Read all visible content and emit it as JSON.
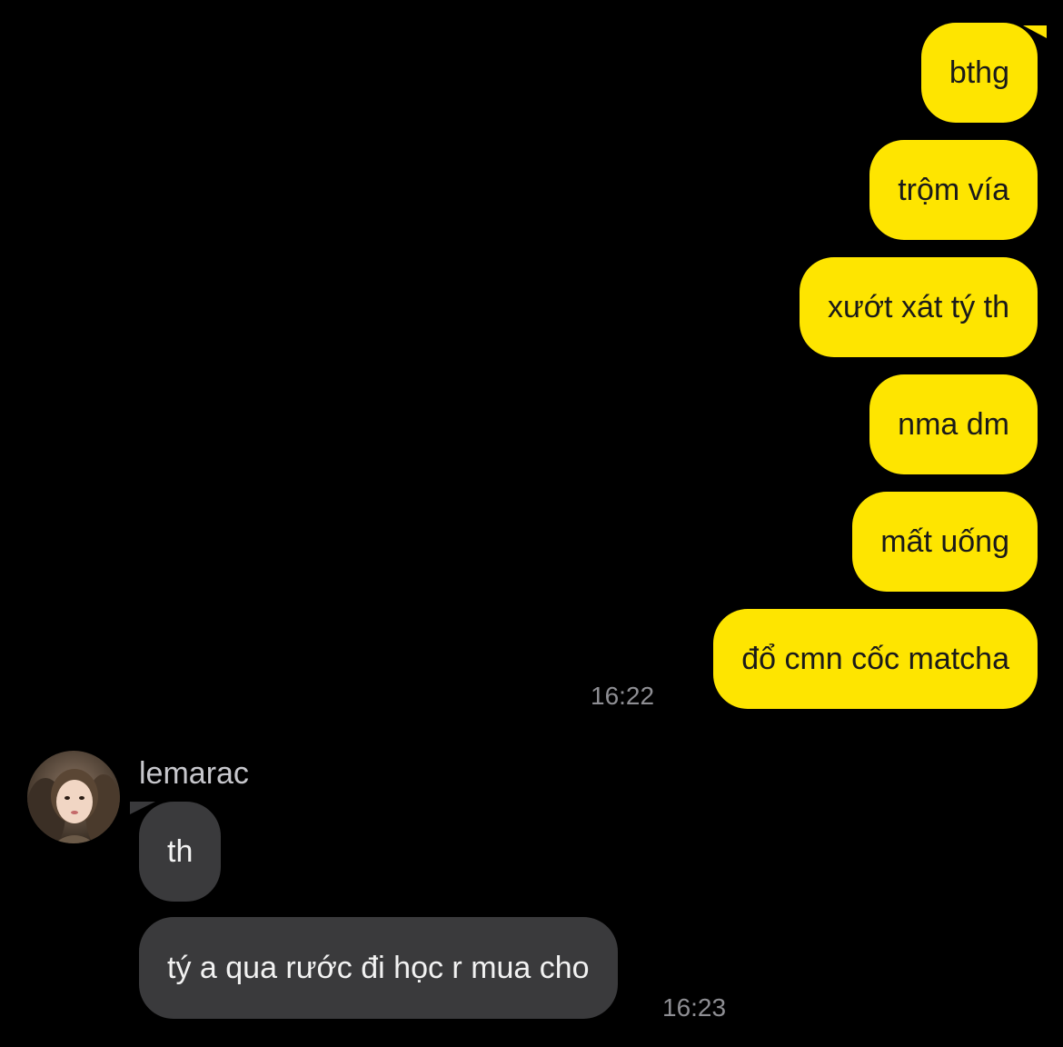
{
  "conversation": {
    "outgoing": [
      {
        "text": "bthg"
      },
      {
        "text": "trộm vía"
      },
      {
        "text": "xướt xát tý th"
      },
      {
        "text": "nma dm"
      },
      {
        "text": "mất uống"
      },
      {
        "text": "đổ cmn cốc matcha"
      }
    ],
    "outgoing_time": "16:22",
    "incoming": {
      "sender": "lemarac",
      "avatar_icon": "user-avatar-photo",
      "messages": [
        {
          "text": "th"
        },
        {
          "text": "tý a qua rước đi học r mua cho"
        }
      ],
      "time": "16:23"
    }
  },
  "colors": {
    "background": "#000000",
    "outgoing_bubble": "#FEE500",
    "incoming_bubble": "#3a3a3c",
    "timestamp": "#8e8e93"
  }
}
